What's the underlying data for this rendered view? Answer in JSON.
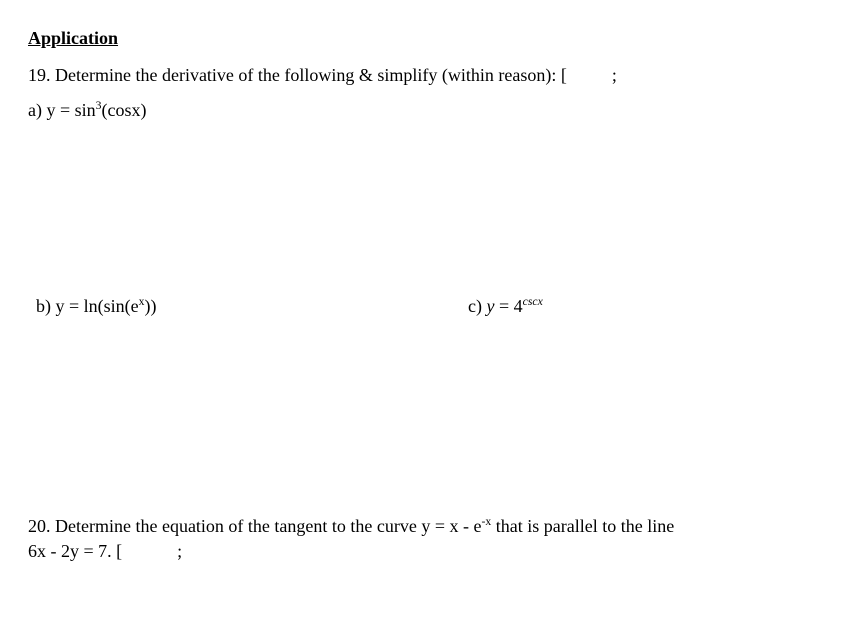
{
  "heading": "Application",
  "q19": {
    "prompt_prefix": "19. Determine the derivative of the following & simplify (within reason): [",
    "prompt_suffix": ";",
    "a_label": "a) y = sin",
    "a_exp": "3",
    "a_tail": "(cosx)",
    "b_label": "b) y = ln(sin(e",
    "b_exp": "x",
    "b_tail": "))",
    "c_label": "c) ",
    "c_eq_lhs": "y",
    "c_eq_mid": " = 4",
    "c_exp": "cscx"
  },
  "q20": {
    "line1_a": "20. Determine the equation of the tangent to the curve y = x - e",
    "line1_exp": "-x",
    "line1_b": " that is parallel to the line",
    "line2_a": "6x - 2y = 7. [",
    "line2_b": ";"
  }
}
